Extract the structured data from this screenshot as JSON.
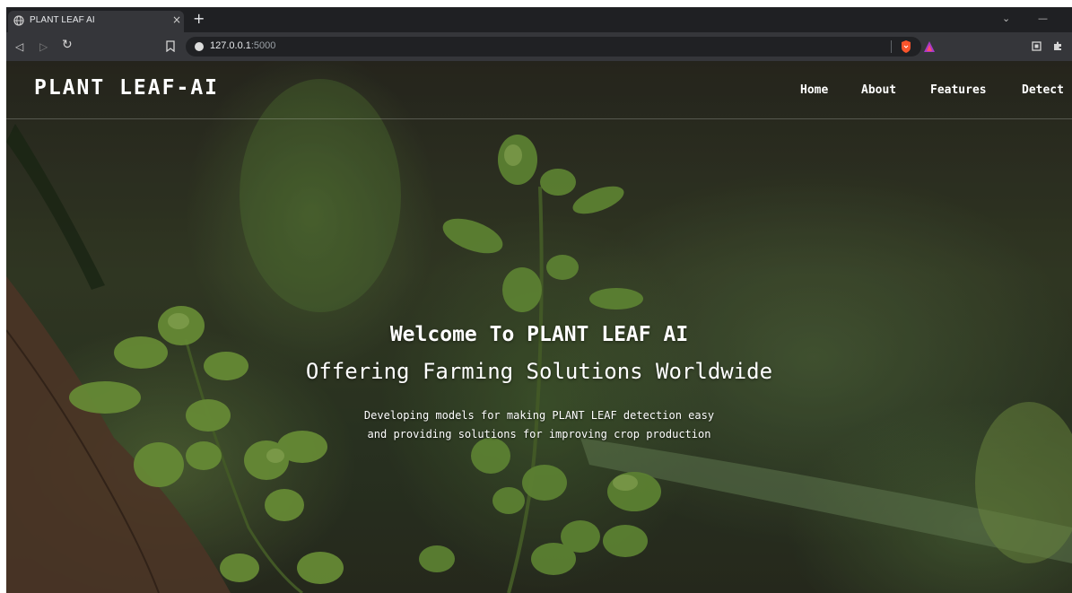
{
  "browser": {
    "tab_title": "PLANT LEAF AI",
    "tab_close_glyph": "×",
    "new_tab_glyph": "+",
    "url_host": "127.0.0.1",
    "url_port": ":5000",
    "icons": [
      "back-icon",
      "forward-icon",
      "reload-icon",
      "bookmark-icon",
      "info-icon",
      "brave-shield-icon",
      "brave-rewards-icon",
      "extensions-icon",
      "puzzle-icon",
      "chevron-down-icon",
      "minimize-icon"
    ]
  },
  "navbar": {
    "brand": "PLANT LEAF-AI",
    "links": [
      "Home",
      "About",
      "Features",
      "Detect"
    ]
  },
  "hero": {
    "title": "Welcome To PLANT LEAF AI",
    "subtitle": "Offering Farming Solutions Worldwide",
    "desc_line1": "Developing models for making PLANT LEAF detection easy",
    "desc_line2": "and providing solutions for improving crop production"
  },
  "colors": {
    "chrome_dark": "#202124",
    "chrome_toolbar": "#35363a",
    "text_white": "#ffffff",
    "brave_orange": "#fb542b"
  }
}
